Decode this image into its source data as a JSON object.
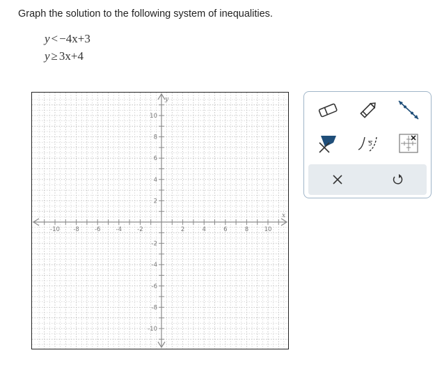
{
  "prompt": "Graph the solution to the following system of inequalities.",
  "inequalities": [
    {
      "lhs": "y",
      "op": "<",
      "rhs": "−4x+3"
    },
    {
      "lhs": "y",
      "op": "≥",
      "rhs": "3x+4"
    }
  ],
  "graph": {
    "x_axis_label": "x",
    "y_axis_label": "y",
    "xlim": [
      -11,
      11
    ],
    "ylim": [
      -11,
      11
    ],
    "labeled_ticks_x": [
      "-10",
      "-8",
      "-6",
      "-4",
      "-2",
      "2",
      "4",
      "6",
      "8",
      "10"
    ],
    "labeled_ticks_y": [
      "10",
      "8",
      "6",
      "4",
      "2",
      "-2",
      "-4",
      "-6",
      "-8",
      "-10"
    ],
    "grid": true,
    "grid_color": "#b9b9b9",
    "axis_color": "#8a8a8a"
  },
  "toolbox": {
    "tools": [
      "eraser-icon",
      "pencil-icon",
      "line-tool-icon",
      "fill-region-icon",
      "curve-tool-icon",
      "grid-settings-icon"
    ],
    "actions": [
      "clear-icon",
      "undo-icon"
    ]
  }
}
